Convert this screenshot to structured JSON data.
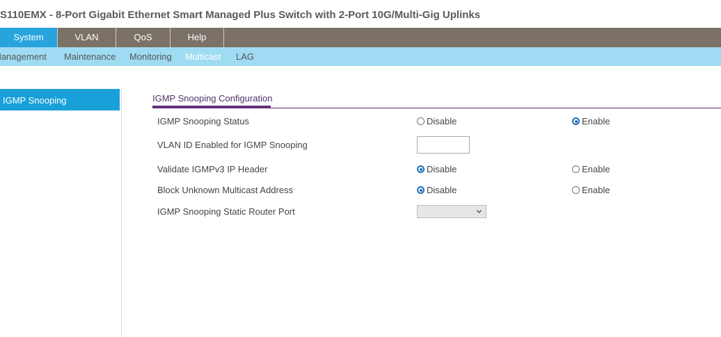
{
  "app_title": "S110EMX - 8-Port Gigabit Ethernet Smart Managed Plus Switch with 2-Port 10G/Multi-Gig Uplinks",
  "top_nav": {
    "tabs": [
      "System",
      "VLAN",
      "QoS",
      "Help"
    ],
    "active": "System"
  },
  "sub_nav": {
    "items": [
      "Management",
      "Maintenance",
      "Monitoring",
      "Multicast",
      "LAG"
    ],
    "active": "Multicast"
  },
  "sidebar": {
    "items": [
      "IGMP Snooping"
    ],
    "active": "IGMP Snooping"
  },
  "section": {
    "title": "IGMP Snooping Configuration"
  },
  "form": {
    "igmp_status": {
      "label": "IGMP Snooping Status",
      "disable": "Disable",
      "enable": "Enable",
      "selected": "Enable"
    },
    "vlan_id": {
      "label": "VLAN ID Enabled for IGMP Snooping",
      "value": ""
    },
    "validate_v3": {
      "label": "Validate IGMPv3 IP Header",
      "disable": "Disable",
      "enable": "Enable",
      "selected": "Disable"
    },
    "block_unknown": {
      "label": "Block Unknown Multicast Address",
      "disable": "Disable",
      "enable": "Enable",
      "selected": "Disable"
    },
    "static_router_port": {
      "label": "IGMP Snooping Static Router Port",
      "value": ""
    }
  },
  "colors": {
    "top_nav_bg": "#7b7166",
    "active_tab": "#27a3dd",
    "sub_nav_bg": "#9fdcf4",
    "section_accent": "#622f7a",
    "radio_on": "#1e6fb8"
  },
  "icons": {
    "select": "chevron-down-icon",
    "radio_on": "radio-selected-icon",
    "radio_off": "radio-unselected-icon"
  }
}
